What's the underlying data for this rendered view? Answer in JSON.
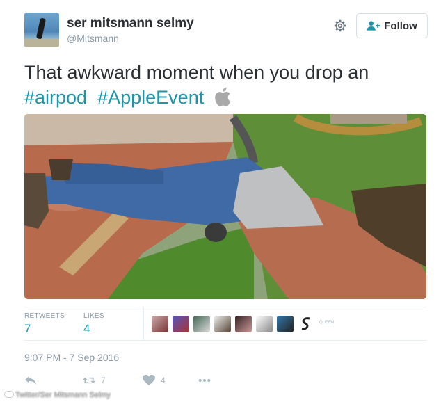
{
  "author": {
    "name": "ser mitsmann selmy",
    "handle": "@Mitsmann"
  },
  "follow_button": {
    "label": "Follow"
  },
  "tweet": {
    "text": "That awkward moment when you drop an",
    "hashtags": [
      "#airpod",
      "#AppleEvent"
    ],
    "emoji_icon": "apple-logo-icon"
  },
  "stats": {
    "retweets_label": "RETWEETS",
    "retweets_value": "7",
    "likes_label": "LIKES",
    "likes_value": "4"
  },
  "likers_caption": "QUEEN",
  "timestamp": "9:07 PM - 7 Sep 2016",
  "actions": {
    "reply_icon": "reply-icon",
    "retweet_count": "7",
    "like_count": "4",
    "more_icon": "more-icon"
  },
  "watermark": "Twitter/Ser Mitsmann Selmy",
  "colors": {
    "accent": "#1b95a8",
    "text": "#292f33",
    "muted": "#8899a6"
  }
}
